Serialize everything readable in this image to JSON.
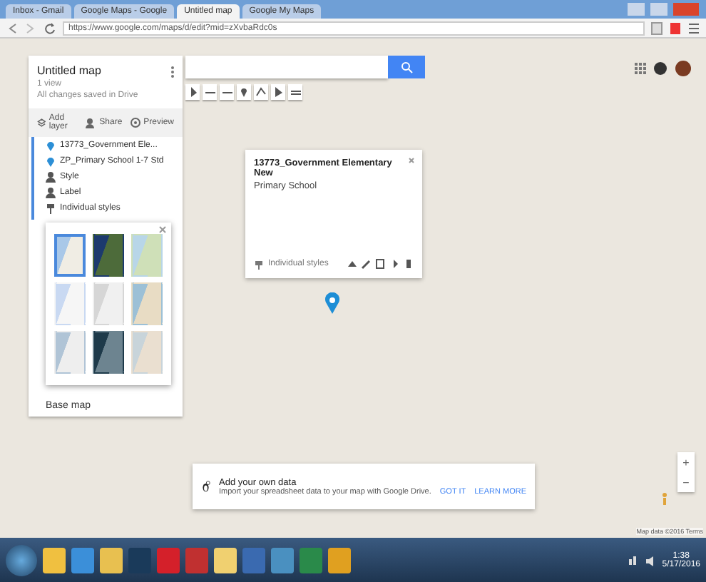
{
  "browser": {
    "tabs": [
      {
        "title": "Inbox - Gmail",
        "selected": false
      },
      {
        "title": "Google Maps - Google",
        "selected": false
      },
      {
        "title": "Untitled map",
        "selected": true
      },
      {
        "title": "Google My Maps",
        "selected": false
      }
    ],
    "url": "https://www.google.com/maps/d/edit?mid=zXvbaRdc0s"
  },
  "sidebar": {
    "title": "Untitled map",
    "views": "1 view",
    "status": "All changes saved in Drive",
    "actions": [
      "Add layer",
      "Share",
      "Preview"
    ],
    "layers": [
      {
        "label": "13773_Government Ele...",
        "kind": "pin"
      },
      {
        "label": "ZP_Primary School 1-7 Std",
        "kind": "pin"
      },
      {
        "label": "Style",
        "kind": "person"
      },
      {
        "label": "Label",
        "kind": "person"
      },
      {
        "label": "Individual styles",
        "kind": "paint"
      }
    ],
    "base_map_label": "Base map"
  },
  "basemaps": [
    {
      "selected": true
    },
    {
      "selected": false
    },
    {
      "selected": false
    },
    {
      "selected": false
    },
    {
      "selected": false
    },
    {
      "selected": false
    },
    {
      "selected": false
    },
    {
      "selected": false
    },
    {
      "selected": false
    }
  ],
  "zoom_controls": [
    "+",
    "−"
  ],
  "popup": {
    "title": "13773_Government Elementary New",
    "subtitle": "Primary School",
    "footer": "Individual styles"
  },
  "notice": {
    "title": "Add your own data",
    "text": "Import your spreadsheet data to your map with Google Drive.",
    "actions": [
      "GOT IT",
      "LEARN MORE"
    ]
  },
  "attribution": "Map data ©2016 Terms",
  "taskbar": {
    "time": "1:38",
    "date": "5/17/2016"
  }
}
